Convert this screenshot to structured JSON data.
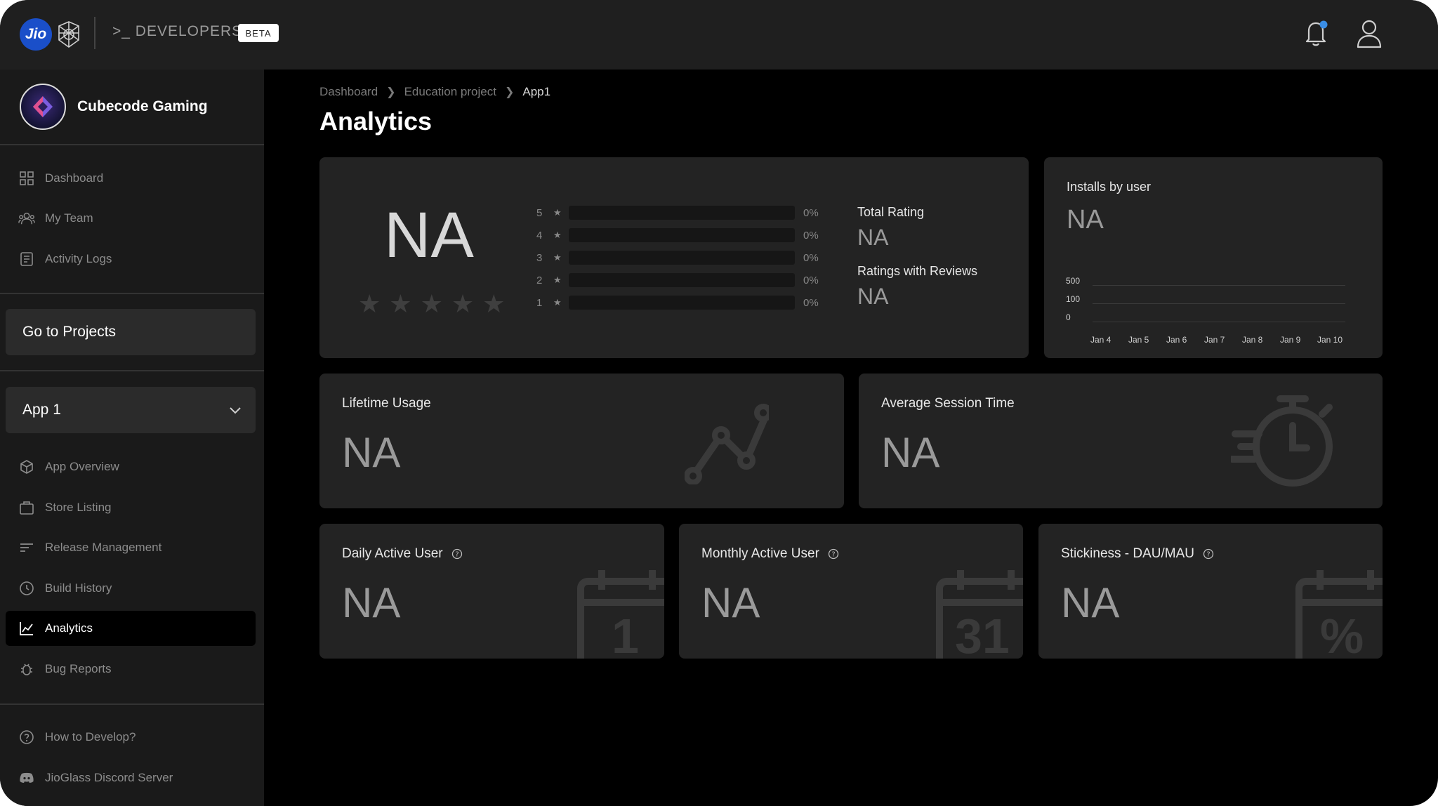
{
  "header": {
    "logo_text": "Jio",
    "developers_label": "DEVELOPERS",
    "beta_label": "BETA",
    "colors": {
      "jio_blue": "#1a4fc9",
      "notification_dot": "#3a8ee6"
    }
  },
  "sidebar": {
    "org_name": "Cubecode Gaming",
    "top_items": [
      {
        "label": "Dashboard",
        "icon": "grid-icon"
      },
      {
        "label": "My Team",
        "icon": "team-icon"
      },
      {
        "label": "Activity Logs",
        "icon": "logs-icon"
      }
    ],
    "go_projects_label": "Go to Projects",
    "app_select_value": "App 1",
    "app_items": [
      {
        "label": "App Overview",
        "icon": "cube-icon"
      },
      {
        "label": "Store Listing",
        "icon": "store-icon"
      },
      {
        "label": "Release Management",
        "icon": "release-icon"
      },
      {
        "label": "Build History",
        "icon": "history-icon"
      },
      {
        "label": "Analytics",
        "icon": "analytics-icon",
        "active": true
      },
      {
        "label": "Bug Reports",
        "icon": "bug-icon"
      }
    ],
    "footer_items": [
      {
        "label": "How to Develop?",
        "icon": "help-circle-icon"
      },
      {
        "label": "JioGlass Discord Server",
        "icon": "discord-icon"
      }
    ]
  },
  "breadcrumb": {
    "items": [
      "Dashboard",
      "Education project",
      "App1"
    ]
  },
  "page_title": "Analytics",
  "ratings_card": {
    "overall": "NA",
    "rows": [
      {
        "stars": "5",
        "pct": "0%"
      },
      {
        "stars": "4",
        "pct": "0%"
      },
      {
        "stars": "3",
        "pct": "0%"
      },
      {
        "stars": "2",
        "pct": "0%"
      },
      {
        "stars": "1",
        "pct": "0%"
      }
    ],
    "total_rating_label": "Total Rating",
    "total_rating_value": "NA",
    "ratings_with_reviews_label": "Ratings with Reviews",
    "ratings_with_reviews_value": "NA"
  },
  "installs_card": {
    "title": "Installs by user",
    "value": "NA",
    "y_ticks": [
      "500",
      "100",
      "0"
    ],
    "x_ticks": [
      "Jan 4",
      "Jan 5",
      "Jan 6",
      "Jan 7",
      "Jan 8",
      "Jan 9",
      "Jan 10"
    ]
  },
  "lifetime_usage": {
    "label": "Lifetime Usage",
    "value": "NA"
  },
  "avg_session": {
    "label": "Average Session Time",
    "value": "NA"
  },
  "dau": {
    "label": "Daily Active User",
    "value": "NA",
    "deco_text": "1"
  },
  "mau": {
    "label": "Monthly Active User",
    "value": "NA",
    "deco_text": "31"
  },
  "stickiness": {
    "label": "Stickiness - DAU/MAU",
    "value": "NA",
    "deco_text": "%"
  }
}
